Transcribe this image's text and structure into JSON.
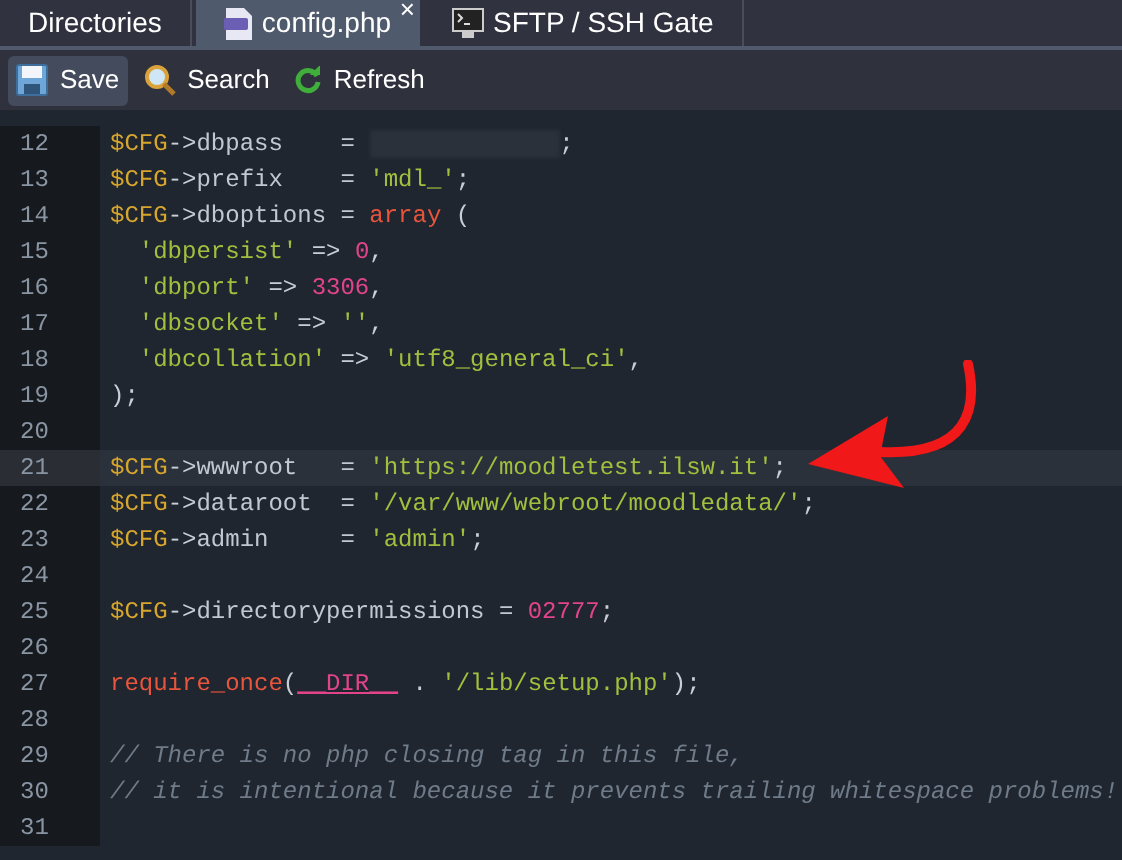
{
  "tabs": [
    {
      "label": "Directories",
      "selected": false,
      "kind": "plain"
    },
    {
      "label": "config.php",
      "selected": true,
      "kind": "php",
      "close": "×"
    },
    {
      "label": "SFTP / SSH Gate",
      "selected": false,
      "kind": "terminal"
    }
  ],
  "toolbar": [
    {
      "label": "Save",
      "kind": "save",
      "selected": true
    },
    {
      "label": "Search",
      "kind": "search",
      "selected": false
    },
    {
      "label": "Refresh",
      "kind": "refresh",
      "selected": false
    }
  ],
  "editor": {
    "lines": [
      {
        "number": "12",
        "selected": false,
        "tokens": [
          {
            "kind": "var",
            "text": "$CFG"
          },
          {
            "kind": "op",
            "text": "->"
          },
          {
            "kind": "prop",
            "text": "dbpass    = "
          },
          {
            "kind": "redacted"
          },
          {
            "kind": "op",
            "text": ";"
          }
        ]
      },
      {
        "number": "13",
        "selected": false,
        "tokens": [
          {
            "kind": "var",
            "text": "$CFG"
          },
          {
            "kind": "op",
            "text": "->"
          },
          {
            "kind": "prop",
            "text": "prefix    = "
          },
          {
            "kind": "str",
            "text": "'mdl_'"
          },
          {
            "kind": "op",
            "text": ";"
          }
        ]
      },
      {
        "number": "14",
        "selected": false,
        "tokens": [
          {
            "kind": "var",
            "text": "$CFG"
          },
          {
            "kind": "op",
            "text": "->"
          },
          {
            "kind": "prop",
            "text": "dboptions = "
          },
          {
            "kind": "kw",
            "text": "array"
          },
          {
            "kind": "op",
            "text": " ("
          }
        ]
      },
      {
        "number": "15",
        "selected": false,
        "tokens": [
          {
            "kind": "str",
            "text": "  'dbpersist'"
          },
          {
            "kind": "op",
            "text": " => "
          },
          {
            "kind": "num",
            "text": "0"
          },
          {
            "kind": "op",
            "text": ","
          }
        ]
      },
      {
        "number": "16",
        "selected": false,
        "tokens": [
          {
            "kind": "str",
            "text": "  'dbport'"
          },
          {
            "kind": "op",
            "text": " => "
          },
          {
            "kind": "num",
            "text": "3306"
          },
          {
            "kind": "op",
            "text": ","
          }
        ]
      },
      {
        "number": "17",
        "selected": false,
        "tokens": [
          {
            "kind": "str",
            "text": "  'dbsocket'"
          },
          {
            "kind": "op",
            "text": " => "
          },
          {
            "kind": "str",
            "text": "''"
          },
          {
            "kind": "op",
            "text": ","
          }
        ]
      },
      {
        "number": "18",
        "selected": false,
        "tokens": [
          {
            "kind": "str",
            "text": "  'dbcollation'"
          },
          {
            "kind": "op",
            "text": " => "
          },
          {
            "kind": "str",
            "text": "'utf8_general_ci'"
          },
          {
            "kind": "op",
            "text": ","
          }
        ]
      },
      {
        "number": "19",
        "selected": false,
        "tokens": [
          {
            "kind": "op",
            "text": ");"
          }
        ]
      },
      {
        "number": "20",
        "selected": false
      },
      {
        "number": "21",
        "selected": true,
        "tokens": [
          {
            "kind": "var",
            "text": "$CFG"
          },
          {
            "kind": "op",
            "text": "->"
          },
          {
            "kind": "prop",
            "text": "wwwroot   = "
          },
          {
            "kind": "str",
            "text": "'https://moodletest.ilsw.it'"
          },
          {
            "kind": "op",
            "text": ";"
          }
        ]
      },
      {
        "number": "22",
        "selected": false,
        "tokens": [
          {
            "kind": "var",
            "text": "$CFG"
          },
          {
            "kind": "op",
            "text": "->"
          },
          {
            "kind": "prop",
            "text": "dataroot  = "
          },
          {
            "kind": "str",
            "text": "'/var/www/webroot/moodledata/'"
          },
          {
            "kind": "op",
            "text": ";"
          }
        ]
      },
      {
        "number": "23",
        "selected": false,
        "tokens": [
          {
            "kind": "var",
            "text": "$CFG"
          },
          {
            "kind": "op",
            "text": "->"
          },
          {
            "kind": "prop",
            "text": "admin     = "
          },
          {
            "kind": "str",
            "text": "'admin'"
          },
          {
            "kind": "op",
            "text": ";"
          }
        ]
      },
      {
        "number": "24",
        "selected": false
      },
      {
        "number": "25",
        "selected": false,
        "tokens": [
          {
            "kind": "var",
            "text": "$CFG"
          },
          {
            "kind": "op",
            "text": "->"
          },
          {
            "kind": "prop",
            "text": "directorypermissions = "
          },
          {
            "kind": "num",
            "text": "02777"
          },
          {
            "kind": "op",
            "text": ";"
          }
        ]
      },
      {
        "number": "26",
        "selected": false
      },
      {
        "number": "27",
        "selected": false,
        "tokens": [
          {
            "kind": "kw",
            "text": "require_once"
          },
          {
            "kind": "op",
            "text": "("
          },
          {
            "kind": "const",
            "text": "__DIR__"
          },
          {
            "kind": "op",
            "text": " . "
          },
          {
            "kind": "str",
            "text": "'/lib/setup.php'"
          },
          {
            "kind": "op",
            "text": ");"
          }
        ]
      },
      {
        "number": "28",
        "selected": false
      },
      {
        "number": "29",
        "selected": false,
        "tokens": [
          {
            "kind": "cmt",
            "text": "// There is no php closing tag in this file,"
          }
        ]
      },
      {
        "number": "30",
        "selected": false,
        "tokens": [
          {
            "kind": "cmt",
            "text": "// it is intentional because it prevents trailing whitespace problems!"
          }
        ]
      },
      {
        "number": "31",
        "selected": false
      }
    ]
  }
}
